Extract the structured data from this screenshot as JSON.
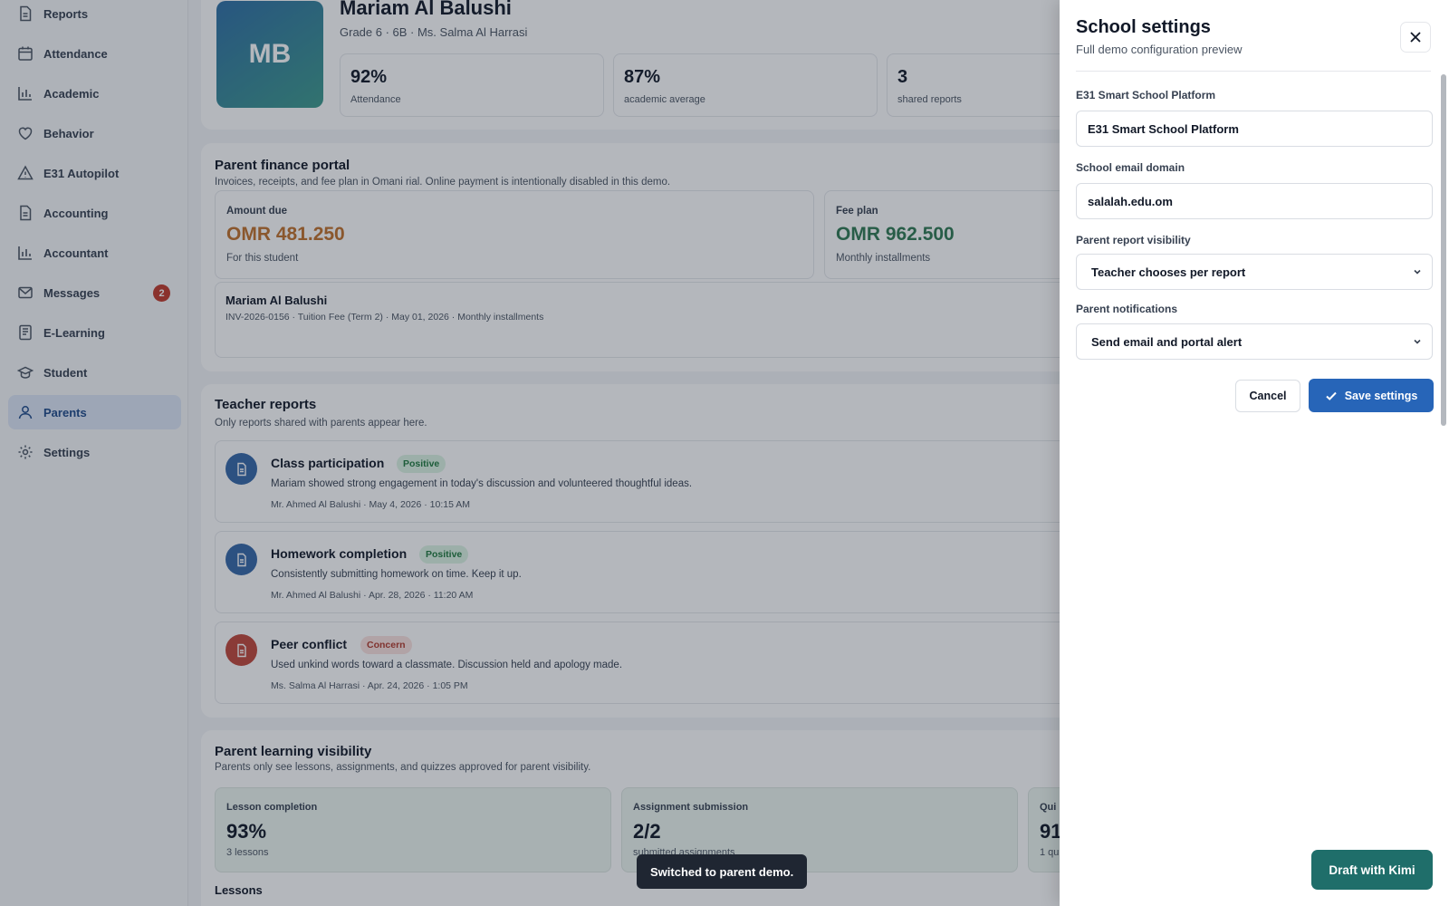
{
  "sidebar": {
    "items": [
      {
        "label": "Reports",
        "icon": "file-icon"
      },
      {
        "label": "Attendance",
        "icon": "calendar-icon"
      },
      {
        "label": "Academic",
        "icon": "bar-chart-icon"
      },
      {
        "label": "Behavior",
        "icon": "heart-icon"
      },
      {
        "label": "E31 Autopilot",
        "icon": "warning-icon"
      },
      {
        "label": "Accounting",
        "icon": "file-icon"
      },
      {
        "label": "Accountant",
        "icon": "bar-chart-icon"
      },
      {
        "label": "Messages",
        "icon": "mail-icon",
        "badge": "2"
      },
      {
        "label": "E-Learning",
        "icon": "book-icon"
      },
      {
        "label": "Student",
        "icon": "graduation-cap-icon"
      },
      {
        "label": "Parents",
        "icon": "user-icon",
        "active": true
      },
      {
        "label": "Settings",
        "icon": "gear-icon"
      }
    ]
  },
  "student": {
    "initials": "MB",
    "name": "Mariam Al Balushi",
    "subtitle": "Grade 6 · 6B · Ms. Salma Al Harrasi",
    "stats": [
      {
        "value": "92%",
        "label": "Attendance"
      },
      {
        "value": "87%",
        "label": "academic average"
      },
      {
        "value": "3",
        "label": "shared reports"
      }
    ]
  },
  "finance": {
    "title": "Parent finance portal",
    "subtitle": "Invoices, receipts, and fee plan in Omani rial. Online payment is intentionally disabled in this demo.",
    "amount_due": {
      "label": "Amount due",
      "value": "OMR 481.250",
      "note": "For this student",
      "color": "#c0702b"
    },
    "fee_plan": {
      "label": "Fee plan",
      "value": "OMR 962.500",
      "note": "Monthly installments",
      "color": "#2f7a52"
    },
    "invoice": {
      "name": "Mariam Al Balushi",
      "detail": "INV-2026-0156 · Tuition Fee (Term 2) · May 01, 2026 · Monthly installments"
    }
  },
  "teacher_reports": {
    "title": "Teacher reports",
    "subtitle": "Only reports shared with parents appear here.",
    "items": [
      {
        "title": "Class participation",
        "tag": "Positive",
        "body": "Mariam showed strong engagement in today's discussion and volunteered thoughtful ideas.",
        "meta": "Mr. Ahmed Al Balushi · May 4, 2026 · 10:15 AM",
        "icon_color": "#3567a8"
      },
      {
        "title": "Homework completion",
        "tag": "Positive",
        "body": "Consistently submitting homework on time. Keep it up.",
        "meta": "Mr. Ahmed Al Balushi · Apr. 28, 2026 · 11:20 AM",
        "icon_color": "#3567a8"
      },
      {
        "title": "Peer conflict",
        "tag": "Concern",
        "body": "Used unkind words toward a classmate. Discussion held and apology made.",
        "meta": "Ms. Salma Al Harrasi · Apr. 24, 2026 · 1:05 PM",
        "icon_color": "#c0463a"
      }
    ]
  },
  "learning": {
    "title": "Parent learning visibility",
    "subtitle": "Parents only see lessons, assignments, and quizzes approved for parent visibility.",
    "boxes": [
      {
        "label": "Lesson completion",
        "value": "93%",
        "note": "3 lessons"
      },
      {
        "label": "Assignment submission",
        "value": "2/2",
        "note": "submitted assignments"
      },
      {
        "label": "Qui",
        "value": "91",
        "note": "1 qu"
      }
    ],
    "lessons_heading": "Lessons"
  },
  "toast": "Switched to parent demo.",
  "settings_panel": {
    "title": "School settings",
    "subtitle": "Full demo configuration preview",
    "fields": {
      "platform_label": "E31 Smart School Platform",
      "platform_value": "E31 Smart School Platform",
      "domain_label": "School email domain",
      "domain_value": "salalah.edu.om",
      "visibility_label": "Parent report visibility",
      "visibility_value": "Teacher chooses per report",
      "notifications_label": "Parent notifications",
      "notifications_value": "Send email and portal alert"
    },
    "cancel_label": "Cancel",
    "save_label": "Save settings",
    "accent": "#2765b8"
  },
  "draft_button": "Draft with Kimi"
}
